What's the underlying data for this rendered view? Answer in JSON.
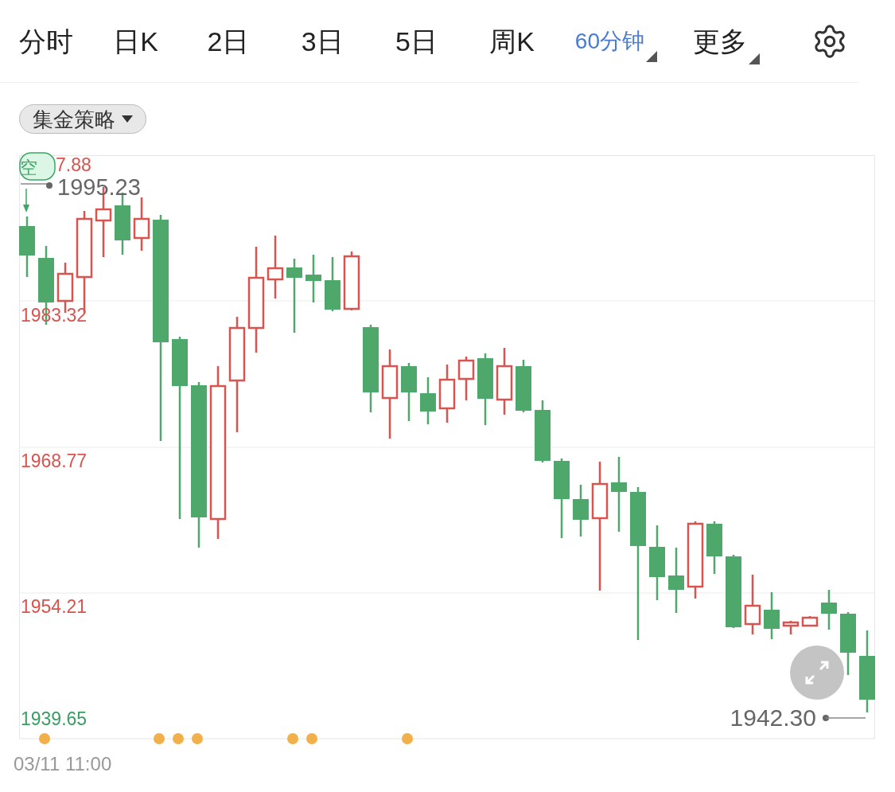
{
  "tabs": [
    {
      "label": "分时",
      "selected": false,
      "kind": "plain"
    },
    {
      "label": "日K",
      "selected": false,
      "kind": "plain"
    },
    {
      "label": "2日",
      "selected": false,
      "kind": "plain"
    },
    {
      "label": "3日",
      "selected": false,
      "kind": "plain"
    },
    {
      "label": "5日",
      "selected": false,
      "kind": "plain"
    },
    {
      "label": "周K",
      "selected": false,
      "kind": "plain"
    },
    {
      "label": "60分钟",
      "selected": true,
      "kind": "dropdown"
    },
    {
      "label": "更多",
      "selected": false,
      "kind": "dropdown"
    }
  ],
  "strategy_selector": {
    "label": "集金策略"
  },
  "chart": {
    "axis_labels": [
      {
        "label": "7.88",
        "color": "#d9534f"
      },
      {
        "label": "1983.32",
        "color": "#d9534f"
      },
      {
        "label": "1968.77",
        "color": "#d9534f"
      },
      {
        "label": "1954.21",
        "color": "#d9534f"
      },
      {
        "label": "1939.65",
        "color": "#3a9d63"
      }
    ],
    "signal_badge": {
      "label": "空",
      "color": "#3aa864"
    },
    "high_label": "1995.23",
    "low_label": "1942.30",
    "time_label": "03/11 11:00"
  }
}
